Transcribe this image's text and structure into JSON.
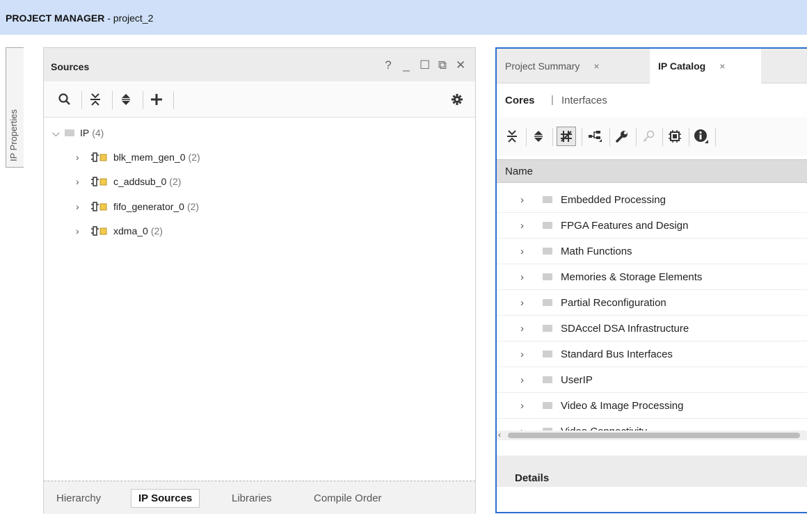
{
  "header": {
    "title_bold": "PROJECT MANAGER",
    "title_rest": " - project_2"
  },
  "side_tab": {
    "label": "IP Properties"
  },
  "sources": {
    "title": "Sources",
    "controls": [
      "?",
      "_",
      "☐",
      "⧉",
      "✕"
    ],
    "tree": {
      "root": {
        "label": "IP",
        "count": "(4)"
      },
      "items": [
        {
          "label": "blk_mem_gen_0",
          "count": "(2)"
        },
        {
          "label": "c_addsub_0",
          "count": "(2)"
        },
        {
          "label": "fifo_generator_0",
          "count": "(2)"
        },
        {
          "label": "xdma_0",
          "count": "(2)"
        }
      ]
    },
    "bottom_tabs": [
      "Hierarchy",
      "IP Sources",
      "Libraries",
      "Compile Order"
    ],
    "active_tab": "IP Sources"
  },
  "catalog": {
    "tabs": [
      {
        "label": "Project Summary",
        "close": "×"
      },
      {
        "label": "IP Catalog",
        "close": "×"
      }
    ],
    "subnav": {
      "cores": "Cores",
      "separator": "|",
      "interfaces": "Interfaces"
    },
    "column_header": "Name",
    "categories": [
      "Embedded Processing",
      "FPGA Features and Design",
      "Math Functions",
      "Memories & Storage Elements",
      "Partial Reconfiguration",
      "SDAccel DSA Infrastructure",
      "Standard Bus Interfaces",
      "UserIP",
      "Video & Image Processing",
      "Video Connectivity"
    ],
    "details_title": "Details"
  },
  "colors": {
    "header_bg": "#cfe0f8",
    "active_border": "#2b6fce",
    "folder": "#cfcfcf",
    "ip_icon_yellow": "#f2c94c"
  }
}
